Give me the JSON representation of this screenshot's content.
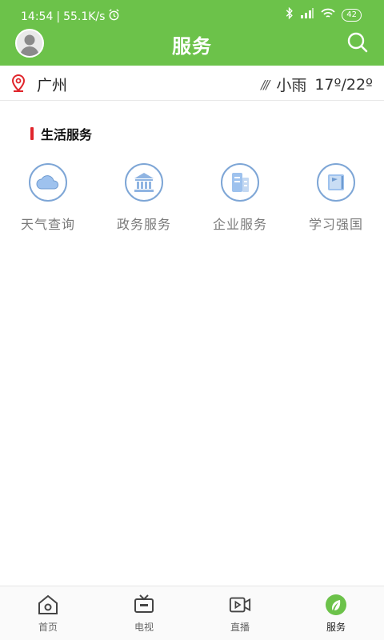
{
  "status_bar": {
    "time": "14:54",
    "net_speed": "55.1K/s",
    "battery": "42"
  },
  "header": {
    "title": "服务",
    "search_icon": "search-icon",
    "avatar_icon": "user-avatar"
  },
  "location": {
    "city": "广州",
    "weather_text": "小雨",
    "temperature": "17º/22º",
    "rain_symbol": "///"
  },
  "section": {
    "title": "生活服务"
  },
  "services": [
    {
      "label": "天气查询",
      "icon": "cloud-icon"
    },
    {
      "label": "政务服务",
      "icon": "government-building-icon"
    },
    {
      "label": "企业服务",
      "icon": "office-building-icon"
    },
    {
      "label": "学习强国",
      "icon": "flag-book-icon"
    }
  ],
  "tabbar": [
    {
      "label": "首页",
      "icon": "home-icon"
    },
    {
      "label": "电视",
      "icon": "tv-icon"
    },
    {
      "label": "直播",
      "icon": "live-video-icon"
    },
    {
      "label": "服务",
      "icon": "compass-leaf-icon",
      "active": true
    }
  ],
  "colors": {
    "brand_green": "#6cc24a",
    "section_accent": "#e0252b",
    "icon_blue": "#7ea6d6"
  }
}
